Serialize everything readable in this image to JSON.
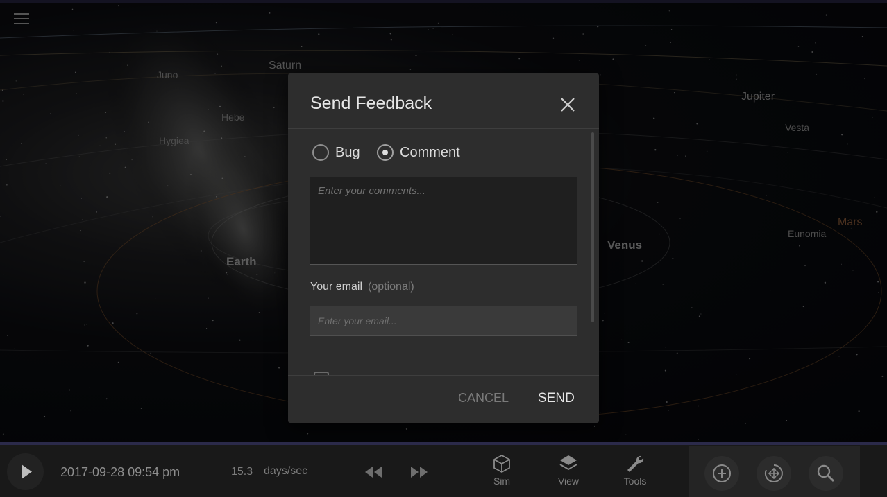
{
  "scene": {
    "planets": {
      "juno": "Juno",
      "saturn": "Saturn",
      "hebe": "Hebe",
      "hygiea": "Hygiea",
      "jupiter": "Jupiter",
      "vesta": "Vesta",
      "earth": "Earth",
      "venus": "Venus",
      "mars": "Mars",
      "eunomia": "Eunomia"
    }
  },
  "dialog": {
    "title": "Send Feedback",
    "type_options": [
      {
        "label": "Bug",
        "checked": false
      },
      {
        "label": "Comment",
        "checked": true
      }
    ],
    "comments_placeholder": "Enter your comments...",
    "email_label": "Your email",
    "email_optional": "(optional)",
    "email_placeholder": "Enter your email...",
    "cancel_label": "CANCEL",
    "send_label": "SEND"
  },
  "bottom_bar": {
    "datetime": "2017-09-28 09:54 pm",
    "rate_value": "15.3",
    "rate_unit": "days/sec",
    "tools": [
      {
        "label": "Sim",
        "icon": "cube-icon"
      },
      {
        "label": "View",
        "icon": "layers-icon"
      },
      {
        "label": "Tools",
        "icon": "wrench-icon"
      }
    ]
  },
  "colors": {
    "dialog_bg": "#2d2d2d",
    "bar_bg": "#191919",
    "accent_line": "#2b2a4a"
  }
}
